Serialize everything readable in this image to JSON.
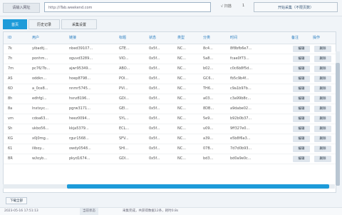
{
  "topbar": {
    "label": "请输入网址",
    "url_value": "http://iTab.weekend.com",
    "settings_label": "√ 扫描",
    "settings_value": "1",
    "action_button": "开始采集（不限页数）"
  },
  "tabs": [
    {
      "label": "首页",
      "active": true
    },
    {
      "label": "历史记录",
      "active": false
    },
    {
      "label": "采集设置",
      "active": false
    }
  ],
  "table": {
    "headers": [
      "ID",
      "用户",
      "链接",
      "标题",
      "状态",
      "类型",
      "分类",
      "时间",
      "备注",
      "操作"
    ],
    "rows": [
      [
        "7k",
        "yibadtj...",
        "nbed39107...",
        "GTE...",
        "0x5f...",
        "NC...",
        "8c4...",
        "8f8bfb6e7...",
        "编辑",
        "删除"
      ],
      [
        "7h",
        "ponhm...",
        "oguvd3289...",
        "VIO...",
        "0x5f...",
        "NC...",
        "5a8...",
        "fcae0f73...",
        "编辑",
        "删除"
      ],
      [
        "7m",
        "pc76/7b...",
        "ajwr95349...",
        "ABO...",
        "0x5f...",
        "NC...",
        "b02...",
        "c0c6b8f5d...",
        "编辑",
        "删除"
      ],
      [
        "AS",
        "oddkn...",
        "hoep8798...",
        "POI...",
        "0x5f...",
        "NC...",
        "GC6...",
        "fb5c9b4f...",
        "编辑",
        "删除"
      ],
      [
        "6D",
        "a_0ce8...",
        "nnmr5745...",
        "PVI...",
        "0x5f...",
        "NC...",
        "TH6...",
        "c9a1b97b...",
        "编辑",
        "删除"
      ],
      [
        "8h",
        "edhfgl...",
        "hsnz8196...",
        "GDI...",
        "0x5f...",
        "NC...",
        "a03...",
        "c3a99b8c...",
        "编辑",
        "删除"
      ],
      [
        "8a",
        "lnxtxyc...",
        "pgrw3171...",
        "GEI...",
        "0x5f...",
        "NC...",
        "8DB...",
        "a9dabe02...",
        "编辑",
        "删除"
      ],
      [
        "vm",
        "cdoa63...",
        "heez0094...",
        "SYL...",
        "0x5f...",
        "NC...",
        "5e9...",
        "b92b0b37...",
        "编辑",
        "删除"
      ],
      [
        "Sh",
        "ukbo56...",
        "kkja5379...",
        "ECL...",
        "0x5f...",
        "NC...",
        "u09...",
        "9ff327e0...",
        "编辑",
        "删除"
      ],
      [
        "KG",
        "x0j0mg...",
        "rgur1568...",
        "SFV...",
        "0x5f...",
        "NC...",
        "a39...",
        "e5b8f6a3...",
        "编辑",
        "删除"
      ],
      [
        "61",
        "iliboy...",
        "owdy0548...",
        "SHI...",
        "0x5f...",
        "NC...",
        "07B...",
        "7d7d0b93...",
        "编辑",
        "删除"
      ],
      [
        "BR",
        "w/ioyb...",
        "pkyd1674...",
        "GDI...",
        "0x5f...",
        "NC...",
        "bd3...",
        "bd0a9e0c...",
        "编辑",
        "删除"
      ]
    ]
  },
  "footer": {
    "small_button": "下载全部"
  },
  "status": {
    "time": "2023-05-16 17:51:13",
    "label": "当前状态",
    "message": "采集完成，共获得数据12条，耗时0.8s"
  }
}
